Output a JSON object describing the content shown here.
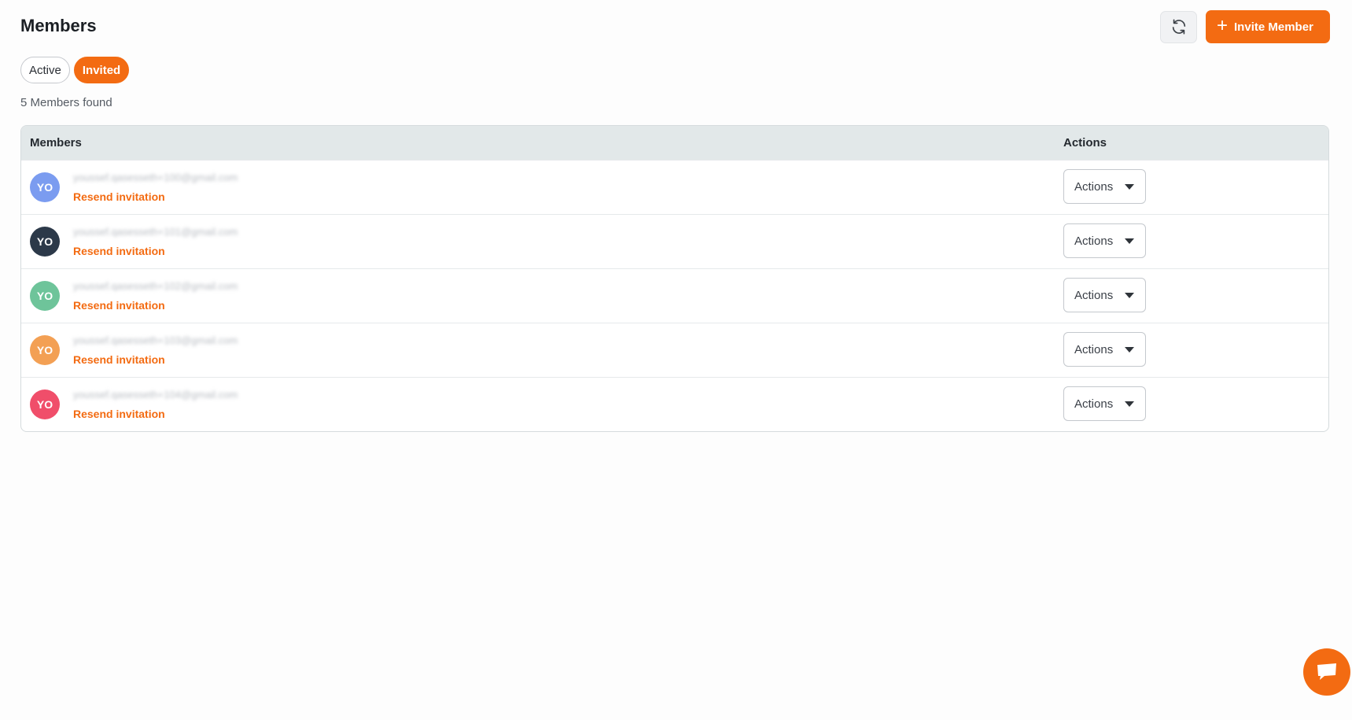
{
  "header": {
    "title": "Members",
    "invite_label": "Invite Member"
  },
  "tabs": [
    {
      "label": "Active"
    },
    {
      "label": "Invited"
    }
  ],
  "count_text": "5 Members found",
  "table": {
    "col_members": "Members",
    "col_actions": "Actions",
    "rows": [
      {
        "initials": "YO",
        "avatar_color": "#7b9cf0",
        "email": "youssef.qasesseth+100@gmail.com",
        "resend": "Resend invitation",
        "actions": "Actions"
      },
      {
        "initials": "YO",
        "avatar_color": "#2c3949",
        "email": "youssef.qasesseth+101@gmail.com",
        "resend": "Resend invitation",
        "actions": "Actions"
      },
      {
        "initials": "YO",
        "avatar_color": "#6ec49a",
        "email": "youssef.qasesseth+102@gmail.com",
        "resend": "Resend invitation",
        "actions": "Actions"
      },
      {
        "initials": "YO",
        "avatar_color": "#f3a054",
        "email": "youssef.qasesseth+103@gmail.com",
        "resend": "Resend invitation",
        "actions": "Actions"
      },
      {
        "initials": "YO",
        "avatar_color": "#f04e6a",
        "email": "youssef.qasesseth+104@gmail.com",
        "resend": "Resend invitation",
        "actions": "Actions"
      }
    ]
  },
  "colors": {
    "accent": "#f36b12",
    "header_bg": "#e2e8e9"
  },
  "icons": {
    "refresh": "refresh-icon",
    "plus": "plus-icon",
    "caret": "caret-down-icon",
    "chat": "chat-icon"
  }
}
